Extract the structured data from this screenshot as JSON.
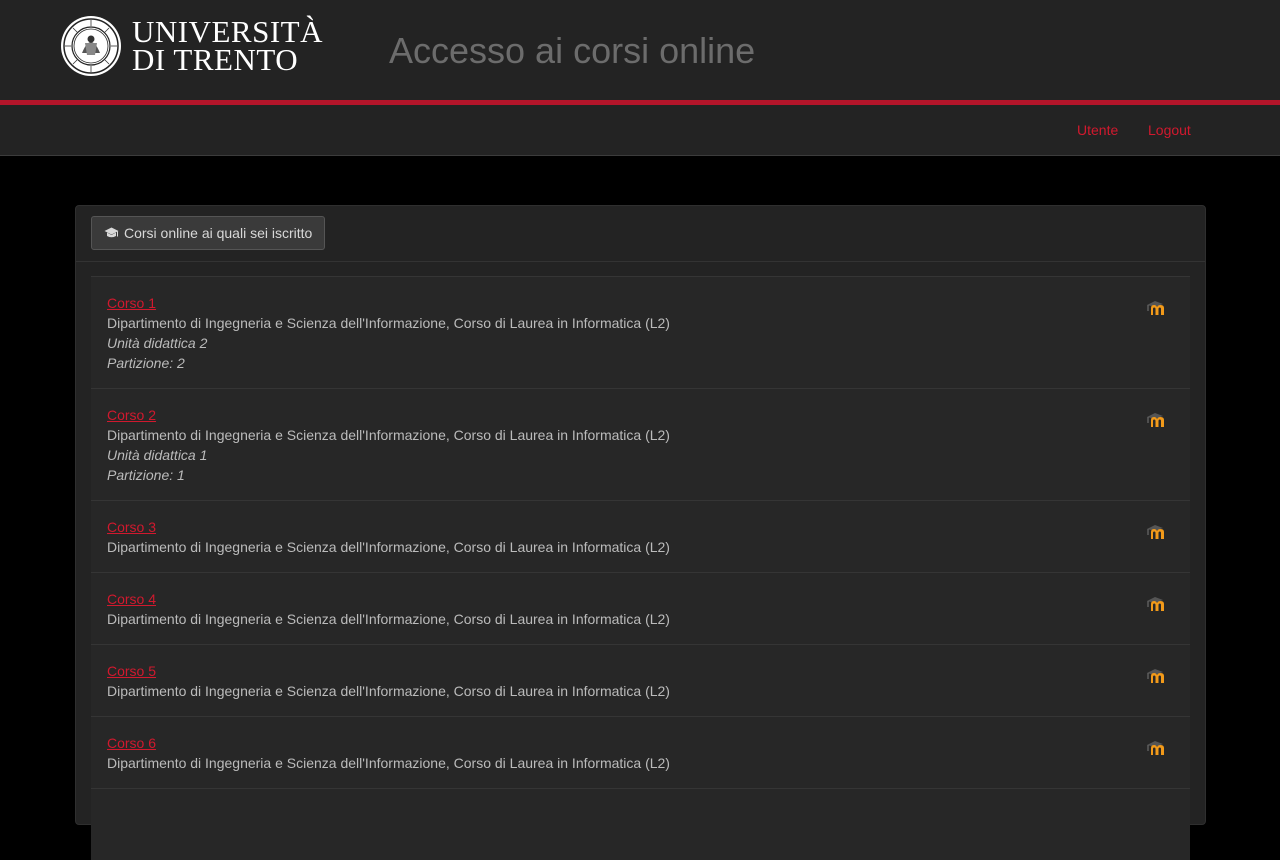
{
  "header": {
    "logo_line1": "UNIVERSITÀ",
    "logo_line2": "DI TRENTO",
    "title": "Accesso ai corsi online"
  },
  "nav": {
    "user": "Utente",
    "logout": "Logout"
  },
  "panel": {
    "heading_button": "Corsi online ai quali sei iscritto",
    "heading_icon": "graduation-cap-icon"
  },
  "courses": [
    {
      "name": "Corso 1",
      "department": "Dipartimento di Ingegneria e Scienza dell'Informazione, Corso di Laurea in Informatica (L2)",
      "unit": "Unità didattica 2",
      "partition": "Partizione: 2",
      "icon": "moodle-icon"
    },
    {
      "name": "Corso 2",
      "department": "Dipartimento di Ingegneria e Scienza dell'Informazione, Corso di Laurea in Informatica (L2)",
      "unit": "Unità didattica 1",
      "partition": "Partizione: 1",
      "icon": "moodle-icon"
    },
    {
      "name": "Corso 3",
      "department": "Dipartimento di Ingegneria e Scienza dell'Informazione, Corso di Laurea in Informatica (L2)",
      "icon": "moodle-icon"
    },
    {
      "name": "Corso 4",
      "department": "Dipartimento di Ingegneria e Scienza dell'Informazione, Corso di Laurea in Informatica (L2)",
      "icon": "moodle-icon"
    },
    {
      "name": "Corso 5",
      "department": "Dipartimento di Ingegneria e Scienza dell'Informazione, Corso di Laurea in Informatica (L2)",
      "icon": "moodle-icon"
    },
    {
      "name": "Corso 6",
      "department": "Dipartimento di Ingegneria e Scienza dell'Informazione, Corso di Laurea in Informatica (L2)",
      "icon": "moodle-icon"
    }
  ],
  "colors": {
    "accent": "#d1192e",
    "brand_bar": "#b3152a",
    "background": "#000000",
    "panel": "#232323"
  }
}
